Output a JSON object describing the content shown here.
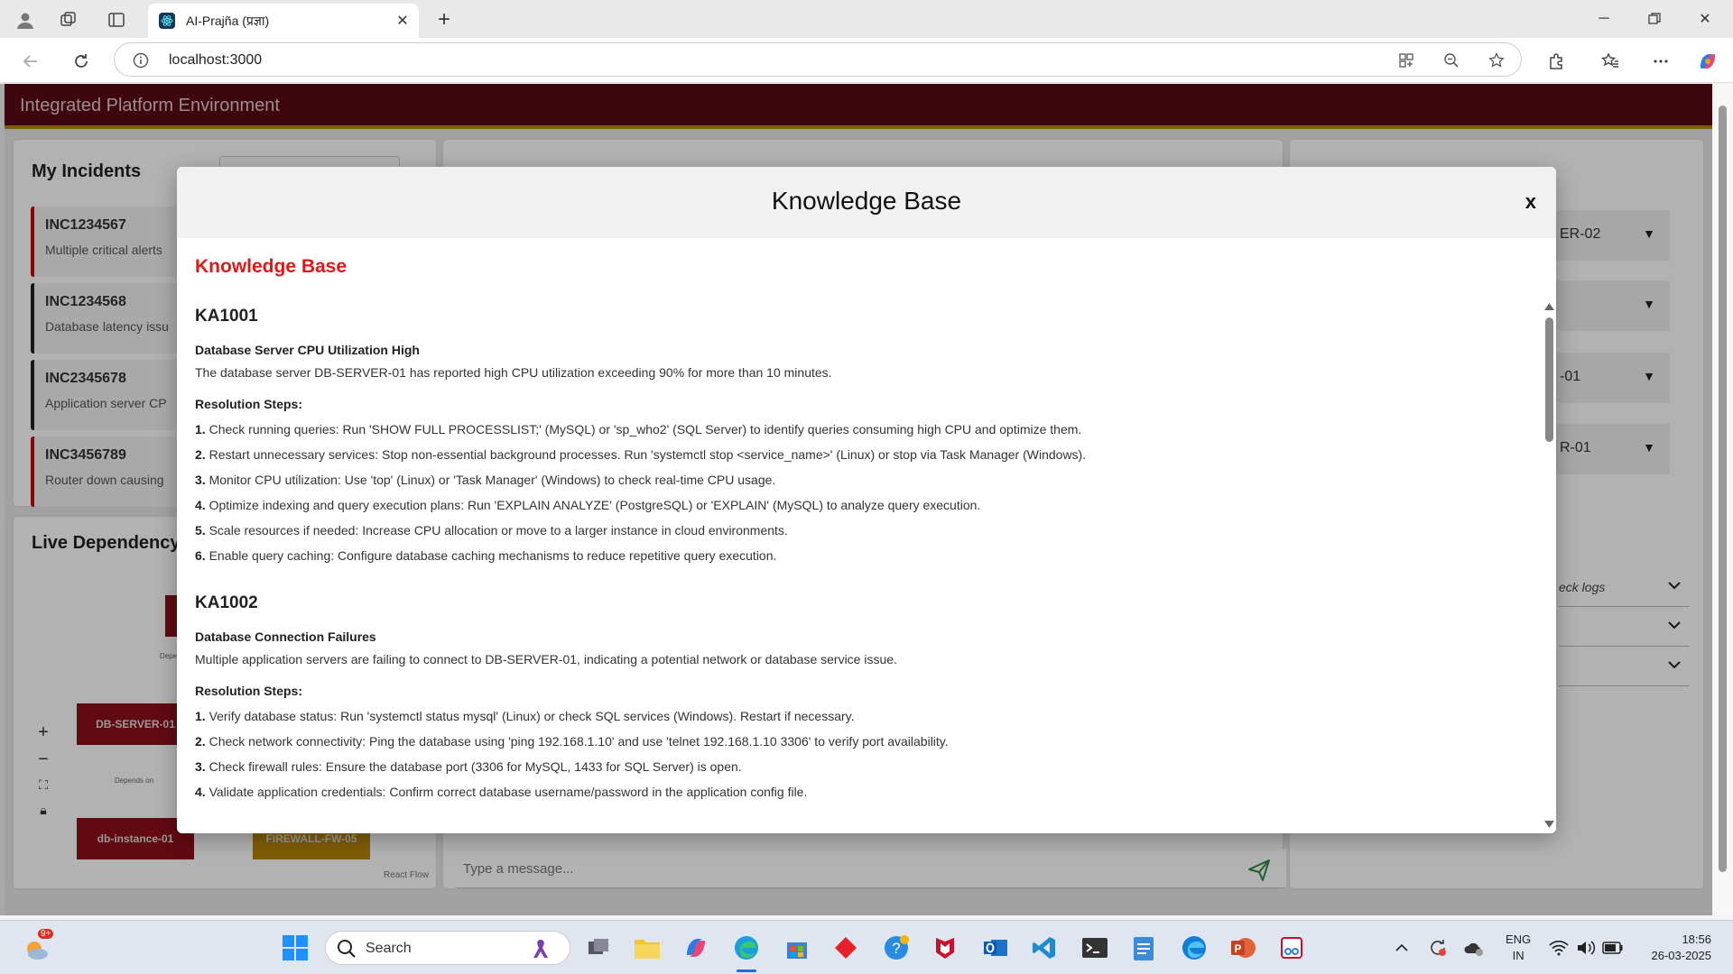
{
  "browser": {
    "tab_title": "AI-Prajña (प्रज्ञा)",
    "url": "localhost:3000"
  },
  "app": {
    "title": "Integrated Platform Environment",
    "incidents_title": "My Incidents",
    "incidents": [
      {
        "id": "INC1234567",
        "desc": "Multiple critical alerts"
      },
      {
        "id": "INC1234568",
        "desc": "Database latency issu"
      },
      {
        "id": "INC2345678",
        "desc": "Application server CP"
      },
      {
        "id": "INC3456789",
        "desc": "Router down causing"
      }
    ],
    "dependency_title": "Live Dependency",
    "nodes": {
      "db_server": "DB-SERVER-01",
      "db_instance": "db-instance-01",
      "firewall": "FIREWALL-FW-05",
      "edge_label_1": "Depe",
      "edge_label_2": "Depends on",
      "react_flow": "React Flow"
    },
    "message_placeholder": "Type a message...",
    "right_selects": [
      "ER-02",
      "",
      "-01",
      "R-01"
    ],
    "accordions": [
      "eck logs",
      "",
      ""
    ]
  },
  "modal": {
    "title": "Knowledge Base",
    "close_label": "x",
    "heading": "Knowledge Base",
    "resolution_label": "Resolution Steps:",
    "articles": [
      {
        "id": "KA1001",
        "title": "Database Server CPU Utilization High",
        "description": "The database server DB-SERVER-01 has reported high CPU utilization exceeding 90% for more than 10 minutes.",
        "steps": [
          {
            "num": "1.",
            "text": "Check running queries: Run 'SHOW FULL PROCESSLIST;' (MySQL) or 'sp_who2' (SQL Server) to identify queries consuming high CPU and optimize them."
          },
          {
            "num": "2.",
            "text": "Restart unnecessary services: Stop non-essential background processes. Run 'systemctl stop <service_name>' (Linux) or stop via Task Manager (Windows)."
          },
          {
            "num": "3.",
            "text": "Monitor CPU utilization: Use 'top' (Linux) or 'Task Manager' (Windows) to check real-time CPU usage."
          },
          {
            "num": "4.",
            "text": "Optimize indexing and query execution plans: Run 'EXPLAIN ANALYZE' (PostgreSQL) or 'EXPLAIN' (MySQL) to analyze query execution."
          },
          {
            "num": "5.",
            "text": "Scale resources if needed: Increase CPU allocation or move to a larger instance in cloud environments."
          },
          {
            "num": "6.",
            "text": "Enable query caching: Configure database caching mechanisms to reduce repetitive query execution."
          }
        ]
      },
      {
        "id": "KA1002",
        "title": "Database Connection Failures",
        "description": "Multiple application servers are failing to connect to DB-SERVER-01, indicating a potential network or database service issue.",
        "steps": [
          {
            "num": "1.",
            "text": "Verify database status: Run 'systemctl status mysql' (Linux) or check SQL services (Windows). Restart if necessary."
          },
          {
            "num": "2.",
            "text": "Check network connectivity: Ping the database using 'ping 192.168.1.10' and use 'telnet 192.168.1.10 3306' to verify port availability."
          },
          {
            "num": "3.",
            "text": "Check firewall rules: Ensure the database port (3306 for MySQL, 1433 for SQL Server) is open."
          },
          {
            "num": "4.",
            "text": "Validate application credentials: Confirm correct database username/password in the application config file."
          }
        ]
      }
    ]
  },
  "taskbar": {
    "search_label": "Search",
    "badge": "9+",
    "lang_1": "ENG",
    "lang_2": "IN",
    "time": "18:56",
    "date": "26-03-2025"
  },
  "colors": {
    "header": "#5a0a15",
    "accent_red": "#e01818",
    "node_red": "#8b0f1a",
    "node_gold": "#b8860b"
  }
}
